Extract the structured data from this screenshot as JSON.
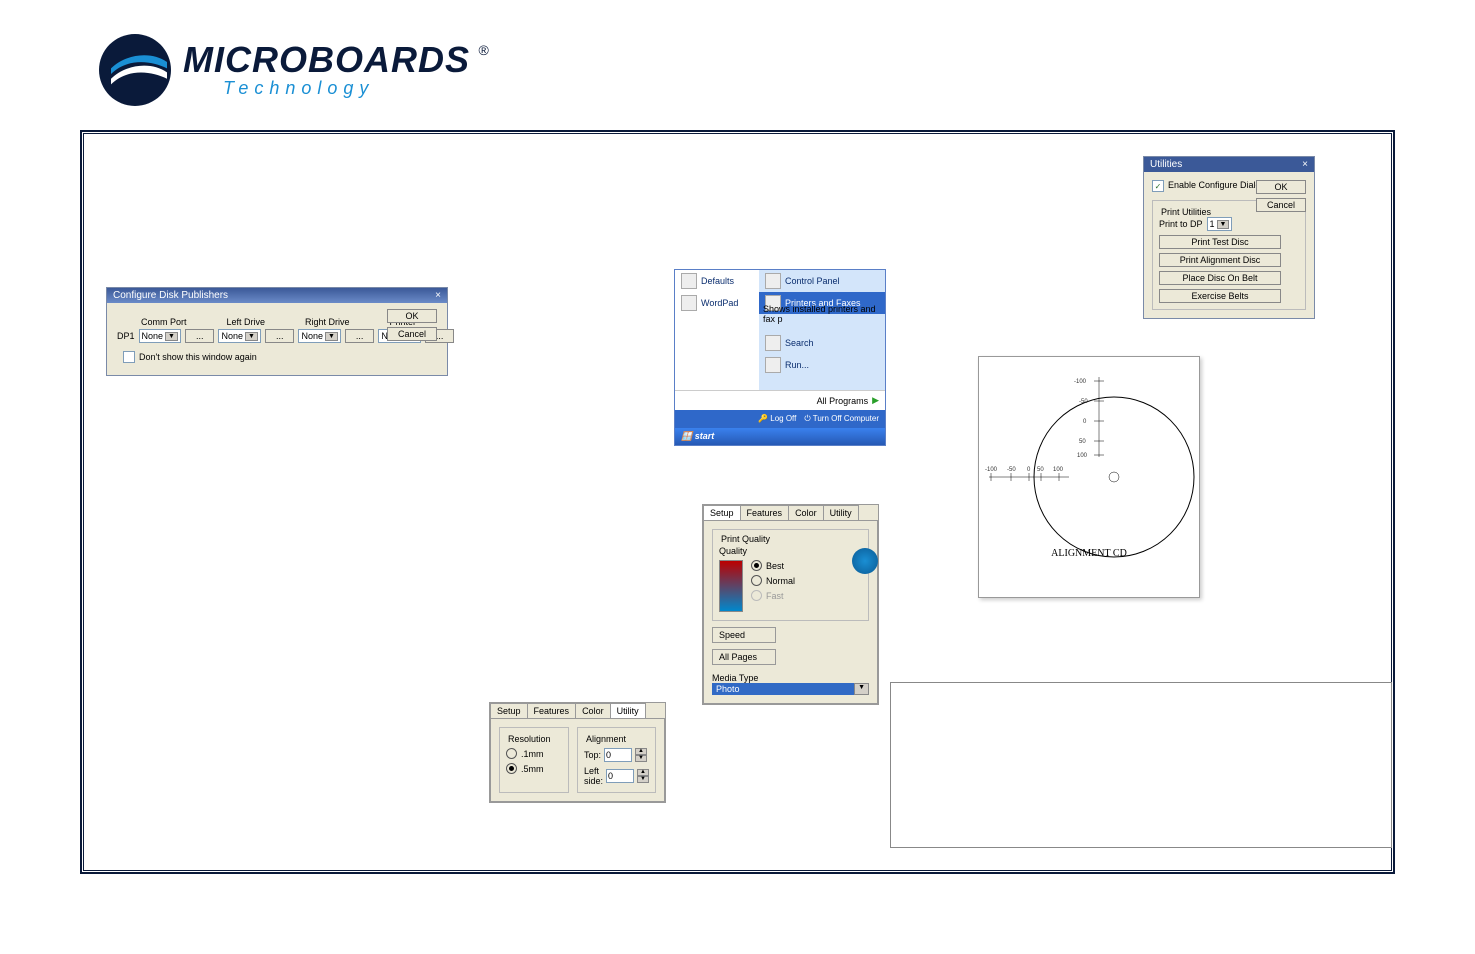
{
  "brand": {
    "name": "MICROBOARDS",
    "sub": "Technology",
    "reg": "®"
  },
  "cfg": {
    "title": "Configure Disk Publishers",
    "ok": "OK",
    "cancel": "Cancel",
    "cols": {
      "comm": "Comm Port",
      "left": "Left Drive",
      "right": "Right Drive",
      "printer": "Printer"
    },
    "rowlabel": "DP1",
    "none": "None",
    "dontshow": "Don't show this window again"
  },
  "util": {
    "title": "Utilities",
    "enable": "Enable Configure Dialog",
    "ok": "OK",
    "cancel": "Cancel",
    "group": "Print Utilities",
    "printto": "Print to DP",
    "dpval": "1",
    "btns": {
      "test": "Print Test Disc",
      "align": "Print Alignment Disc",
      "place": "Place Disc On Belt",
      "ex": "Exercise Belts"
    }
  },
  "start": {
    "defaults": "Defaults",
    "wordpad": "WordPad",
    "control": "Control Panel",
    "printers": "Printers and Faxes",
    "tooltip": "Shows installed printers and fax p",
    "search": "Search",
    "run": "Run...",
    "allprog": "All Programs",
    "logoff": "Log Off",
    "turnoff": "Turn Off Computer",
    "start": "start"
  },
  "tabs": {
    "setup": "Setup",
    "features": "Features",
    "color": "Color",
    "utility": "Utility"
  },
  "t1": {
    "pq": "Print Quality",
    "quality": "Quality",
    "best": "Best",
    "normal": "Normal",
    "fast": "Fast",
    "speed": "Speed",
    "allpages": "All Pages",
    "media": "Media Type",
    "photo": "Photo"
  },
  "t2": {
    "res": "Resolution",
    "r1": ".1mm",
    "r2": ".5mm",
    "align": "Alignment",
    "top": "Top:",
    "left": "Left side:",
    "v": "0"
  },
  "alignlbl": "ALIGNMENT CD",
  "scale": {
    "m100": "-100",
    "m50": "-50",
    "z": "0",
    "p50": "50",
    "p100": "100"
  }
}
